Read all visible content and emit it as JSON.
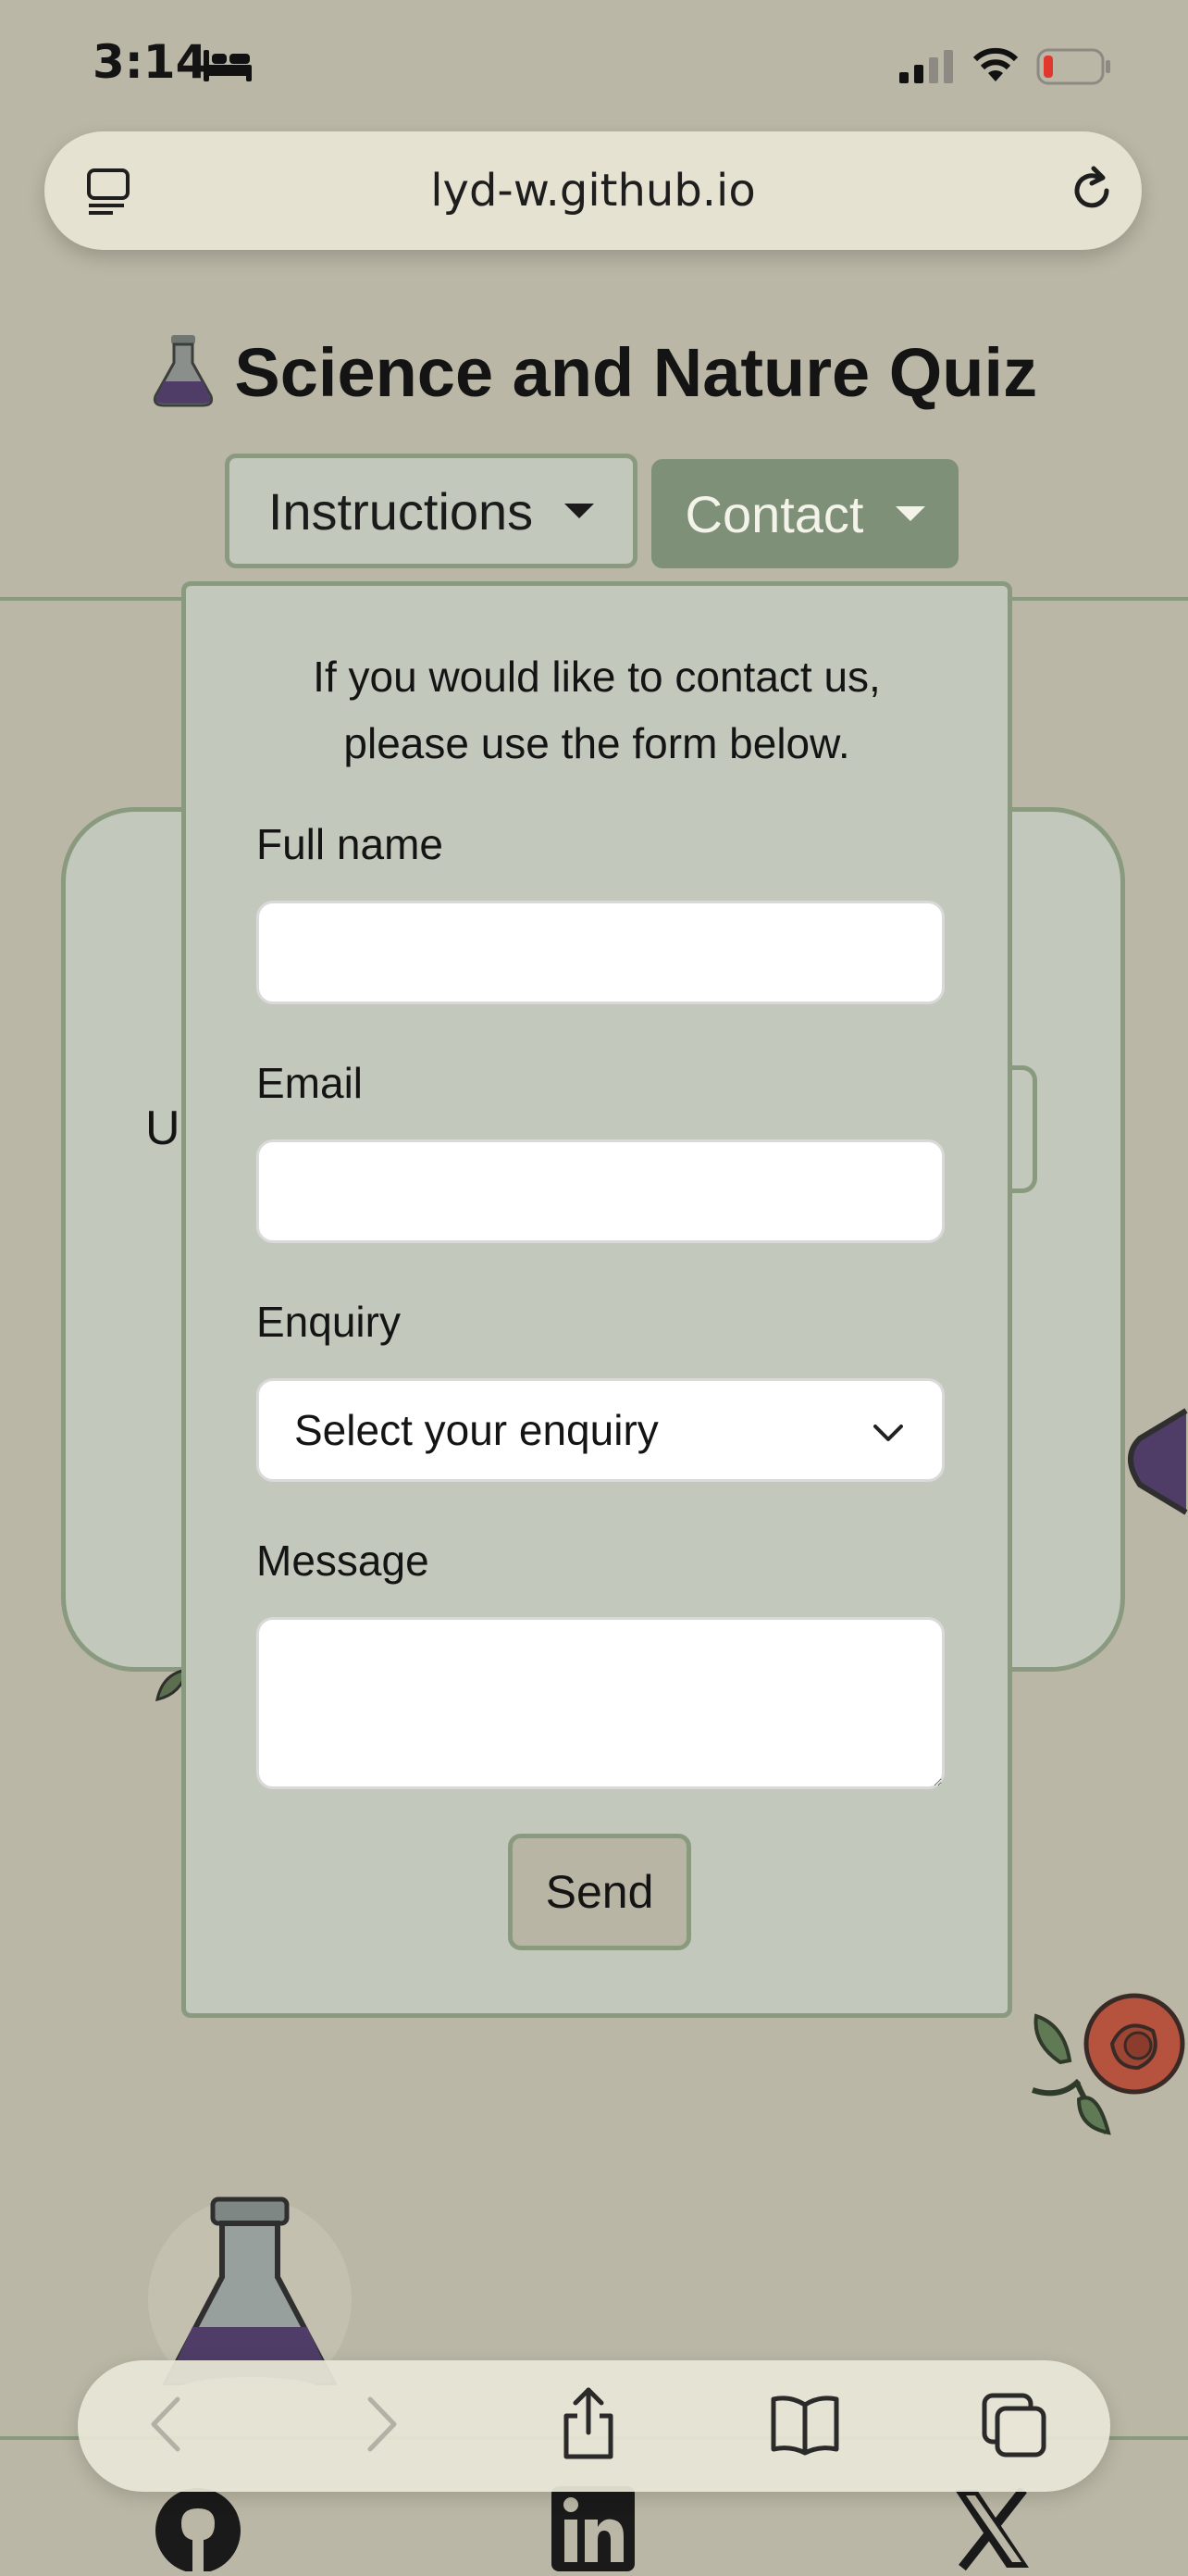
{
  "status_bar": {
    "time": "3:14"
  },
  "browser": {
    "url": "lyd-w.github.io"
  },
  "header": {
    "title": "Science and Nature Quiz"
  },
  "nav": {
    "instructions_label": "Instructions",
    "contact_label": "Contact"
  },
  "background_card": {
    "peek_text": "U"
  },
  "contact_form": {
    "intro_line1": "If you would like to contact us,",
    "intro_line2": "please use the form below.",
    "full_name_label": "Full name",
    "full_name_value": "",
    "email_label": "Email",
    "email_value": "",
    "enquiry_label": "Enquiry",
    "enquiry_selected": "Select your enquiry",
    "message_label": "Message",
    "message_value": "",
    "send_label": "Send"
  },
  "footer_icons": [
    "github-icon",
    "linkedin-icon",
    "x-icon"
  ],
  "colors": {
    "background": "#bbb7a6",
    "panel": "#c2c8bc",
    "border": "#8a9a7e",
    "contact_button": "#7e9077"
  }
}
